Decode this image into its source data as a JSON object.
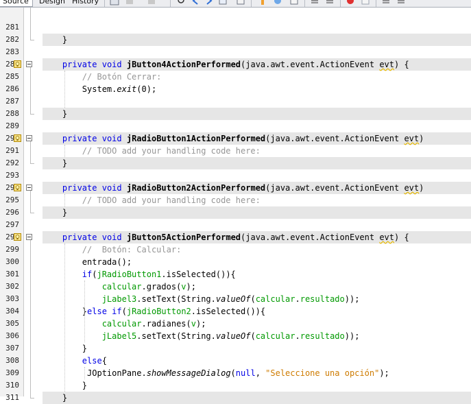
{
  "toolbar": {
    "tabs": [
      "Source",
      "Design",
      "History"
    ]
  },
  "lines": [
    {
      "n": "281",
      "tokens": []
    },
    {
      "n": "282",
      "tokens": [
        {
          "t": "    }",
          "c": ""
        }
      ],
      "hl": true
    },
    {
      "n": "283",
      "tokens": []
    },
    {
      "n": "284",
      "tokens": [
        {
          "t": "    ",
          "c": ""
        },
        {
          "t": "private",
          "c": "kw"
        },
        {
          "t": " ",
          "c": ""
        },
        {
          "t": "void",
          "c": "kw"
        },
        {
          "t": " ",
          "c": ""
        },
        {
          "t": "jButton4ActionPerformed",
          "c": "b"
        },
        {
          "t": "(java.awt.event.ActionEvent ",
          "c": ""
        },
        {
          "t": "evt",
          "c": "wave"
        },
        {
          "t": ") {",
          "c": ""
        }
      ],
      "hl": true,
      "badge": true,
      "fold": true
    },
    {
      "n": "285",
      "tokens": [
        {
          "t": "        // Botón Cerrar:",
          "c": "cm"
        }
      ]
    },
    {
      "n": "286",
      "tokens": [
        {
          "t": "        System.",
          "c": ""
        },
        {
          "t": "exit",
          "c": "it"
        },
        {
          "t": "(0);",
          "c": ""
        }
      ]
    },
    {
      "n": "287",
      "tokens": []
    },
    {
      "n": "288",
      "tokens": [
        {
          "t": "    }",
          "c": ""
        }
      ],
      "hl": true
    },
    {
      "n": "289",
      "tokens": []
    },
    {
      "n": "290",
      "tokens": [
        {
          "t": "    ",
          "c": ""
        },
        {
          "t": "private",
          "c": "kw"
        },
        {
          "t": " ",
          "c": ""
        },
        {
          "t": "void",
          "c": "kw"
        },
        {
          "t": " ",
          "c": ""
        },
        {
          "t": "jRadioButton1ActionPerformed",
          "c": "b"
        },
        {
          "t": "(java.awt.event.ActionEvent ",
          "c": ""
        },
        {
          "t": "evt",
          "c": "wave"
        },
        {
          "t": ")",
          "c": ""
        }
      ],
      "hl": true,
      "badge": true,
      "fold": true
    },
    {
      "n": "291",
      "tokens": [
        {
          "t": "        // TODO add your handling code here:",
          "c": "cm"
        }
      ]
    },
    {
      "n": "292",
      "tokens": [
        {
          "t": "    }",
          "c": ""
        }
      ],
      "hl": true
    },
    {
      "n": "293",
      "tokens": []
    },
    {
      "n": "294",
      "tokens": [
        {
          "t": "    ",
          "c": ""
        },
        {
          "t": "private",
          "c": "kw"
        },
        {
          "t": " ",
          "c": ""
        },
        {
          "t": "void",
          "c": "kw"
        },
        {
          "t": " ",
          "c": ""
        },
        {
          "t": "jRadioButton2ActionPerformed",
          "c": "b"
        },
        {
          "t": "(java.awt.event.ActionEvent ",
          "c": ""
        },
        {
          "t": "evt",
          "c": "wave"
        },
        {
          "t": ")",
          "c": ""
        }
      ],
      "hl": true,
      "badge": true,
      "fold": true
    },
    {
      "n": "295",
      "tokens": [
        {
          "t": "        // TODO add your handling code here:",
          "c": "cm"
        }
      ]
    },
    {
      "n": "296",
      "tokens": [
        {
          "t": "    }",
          "c": ""
        }
      ],
      "hl": true
    },
    {
      "n": "297",
      "tokens": []
    },
    {
      "n": "298",
      "tokens": [
        {
          "t": "    ",
          "c": ""
        },
        {
          "t": "private",
          "c": "kw"
        },
        {
          "t": " ",
          "c": ""
        },
        {
          "t": "void",
          "c": "kw"
        },
        {
          "t": " ",
          "c": ""
        },
        {
          "t": "jButton5ActionPerformed",
          "c": "b"
        },
        {
          "t": "(java.awt.event.ActionEvent ",
          "c": ""
        },
        {
          "t": "evt",
          "c": "wave"
        },
        {
          "t": ") {",
          "c": ""
        }
      ],
      "hl": true,
      "badge": true,
      "fold": true
    },
    {
      "n": "299",
      "tokens": [
        {
          "t": "        //  Botón: Calcular:",
          "c": "cm"
        }
      ]
    },
    {
      "n": "300",
      "tokens": [
        {
          "t": "        entrada();",
          "c": ""
        }
      ]
    },
    {
      "n": "301",
      "tokens": [
        {
          "t": "        ",
          "c": ""
        },
        {
          "t": "if",
          "c": "kw"
        },
        {
          "t": "(",
          "c": ""
        },
        {
          "t": "jRadioButton1",
          "c": "fld"
        },
        {
          "t": ".isSelected()){",
          "c": ""
        }
      ]
    },
    {
      "n": "302",
      "tokens": [
        {
          "t": "            ",
          "c": ""
        },
        {
          "t": "calcular",
          "c": "fld"
        },
        {
          "t": ".grados(",
          "c": ""
        },
        {
          "t": "v",
          "c": "fld"
        },
        {
          "t": ");",
          "c": ""
        }
      ]
    },
    {
      "n": "303",
      "tokens": [
        {
          "t": "            ",
          "c": ""
        },
        {
          "t": "jLabel3",
          "c": "fld"
        },
        {
          "t": ".setText(String.",
          "c": ""
        },
        {
          "t": "valueOf",
          "c": "it"
        },
        {
          "t": "(",
          "c": ""
        },
        {
          "t": "calcular",
          "c": "fld"
        },
        {
          "t": ".",
          "c": ""
        },
        {
          "t": "resultado",
          "c": "fld"
        },
        {
          "t": "));",
          "c": ""
        }
      ]
    },
    {
      "n": "304",
      "tokens": [
        {
          "t": "        }",
          "c": ""
        },
        {
          "t": "else if",
          "c": "kw"
        },
        {
          "t": "(",
          "c": ""
        },
        {
          "t": "jRadioButton2",
          "c": "fld"
        },
        {
          "t": ".isSelected()){",
          "c": ""
        }
      ]
    },
    {
      "n": "305",
      "tokens": [
        {
          "t": "            ",
          "c": ""
        },
        {
          "t": "calcular",
          "c": "fld"
        },
        {
          "t": ".radianes(",
          "c": ""
        },
        {
          "t": "v",
          "c": "fld"
        },
        {
          "t": ");",
          "c": ""
        }
      ]
    },
    {
      "n": "306",
      "tokens": [
        {
          "t": "            ",
          "c": ""
        },
        {
          "t": "jLabel5",
          "c": "fld"
        },
        {
          "t": ".setText(String.",
          "c": ""
        },
        {
          "t": "valueOf",
          "c": "it"
        },
        {
          "t": "(",
          "c": ""
        },
        {
          "t": "calcular",
          "c": "fld"
        },
        {
          "t": ".",
          "c": ""
        },
        {
          "t": "resultado",
          "c": "fld"
        },
        {
          "t": "));",
          "c": ""
        }
      ]
    },
    {
      "n": "307",
      "tokens": [
        {
          "t": "        }",
          "c": ""
        }
      ]
    },
    {
      "n": "308",
      "tokens": [
        {
          "t": "        ",
          "c": ""
        },
        {
          "t": "else",
          "c": "kw"
        },
        {
          "t": "{",
          "c": ""
        }
      ]
    },
    {
      "n": "309",
      "tokens": [
        {
          "t": "         JOptionPane.",
          "c": ""
        },
        {
          "t": "showMessageDialog",
          "c": "it"
        },
        {
          "t": "(",
          "c": ""
        },
        {
          "t": "null",
          "c": "kw"
        },
        {
          "t": ", ",
          "c": ""
        },
        {
          "t": "\"Seleccione una opción\"",
          "c": "str"
        },
        {
          "t": ");",
          "c": ""
        }
      ]
    },
    {
      "n": "310",
      "tokens": [
        {
          "t": "        }",
          "c": ""
        }
      ]
    },
    {
      "n": "311",
      "tokens": [
        {
          "t": "    }",
          "c": ""
        }
      ],
      "hl": true
    }
  ]
}
